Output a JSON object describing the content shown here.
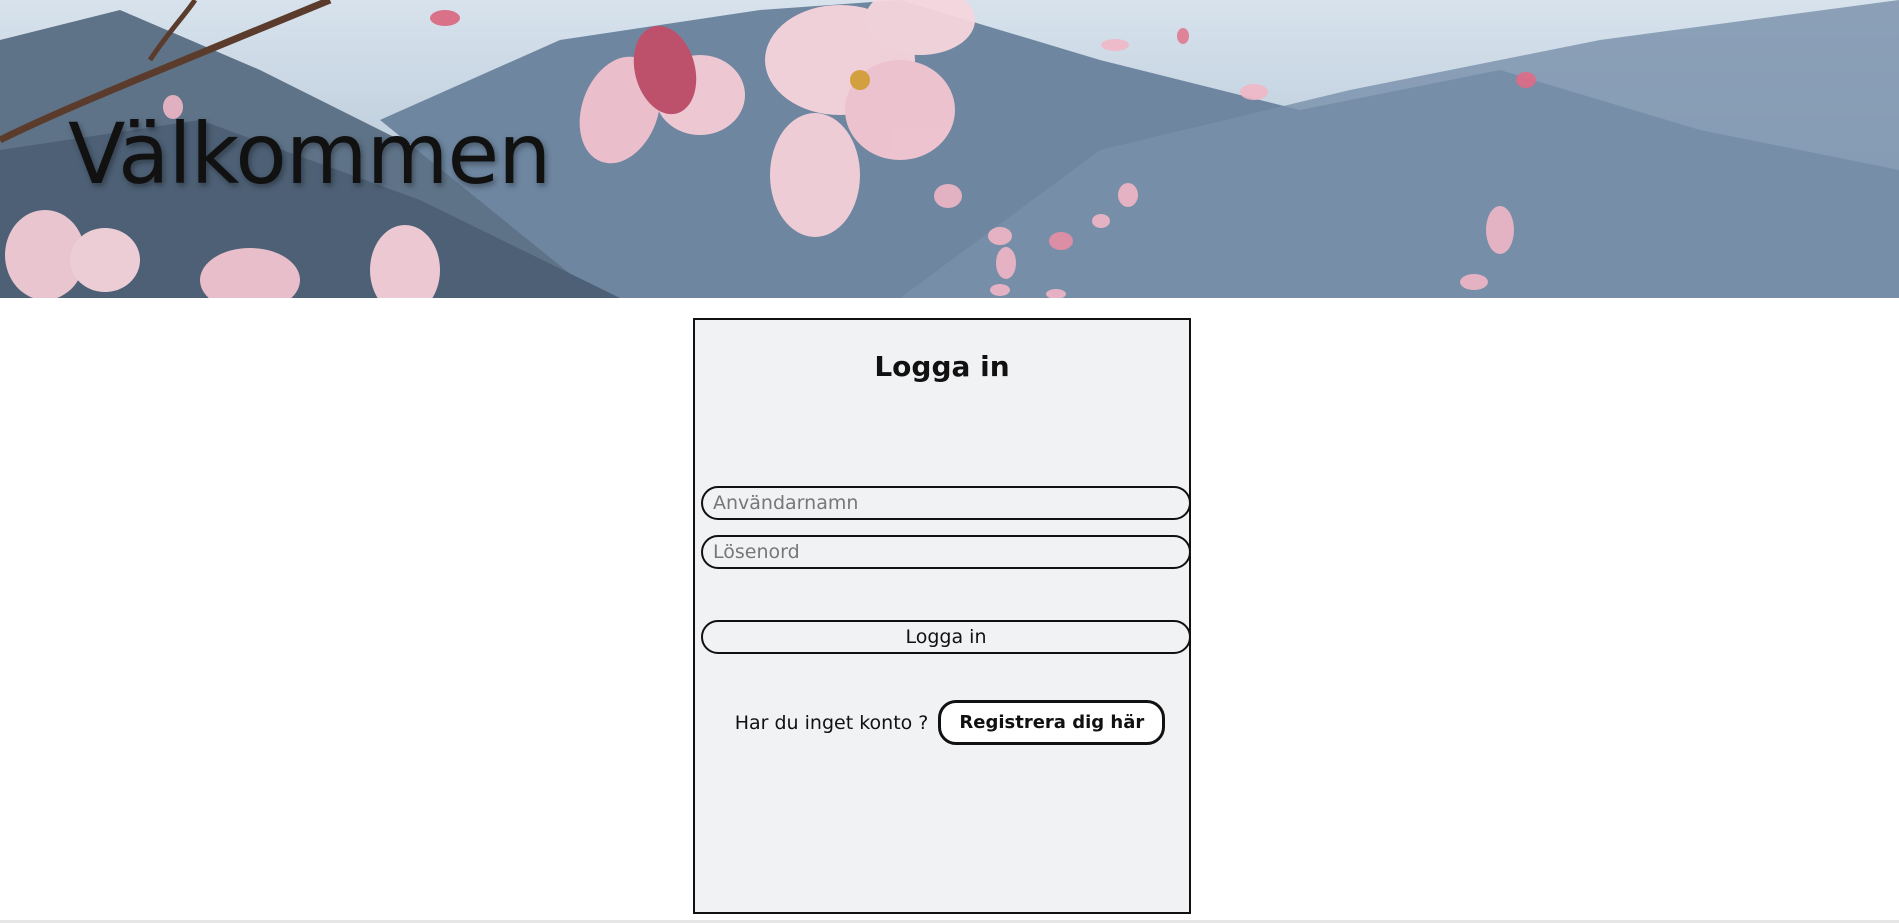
{
  "hero": {
    "title": "Välkommen"
  },
  "login": {
    "heading": "Logga in",
    "username_placeholder": "Användarnamn",
    "username_value": "",
    "password_placeholder": "Lösenord",
    "password_value": "",
    "submit_label": "Logga in",
    "register_prompt": "Har du inget konto ?",
    "register_label": "Registrera dig här"
  },
  "colors": {
    "card_background": "#f1f2f4",
    "border": "#111111",
    "page_background": "#ffffff"
  }
}
